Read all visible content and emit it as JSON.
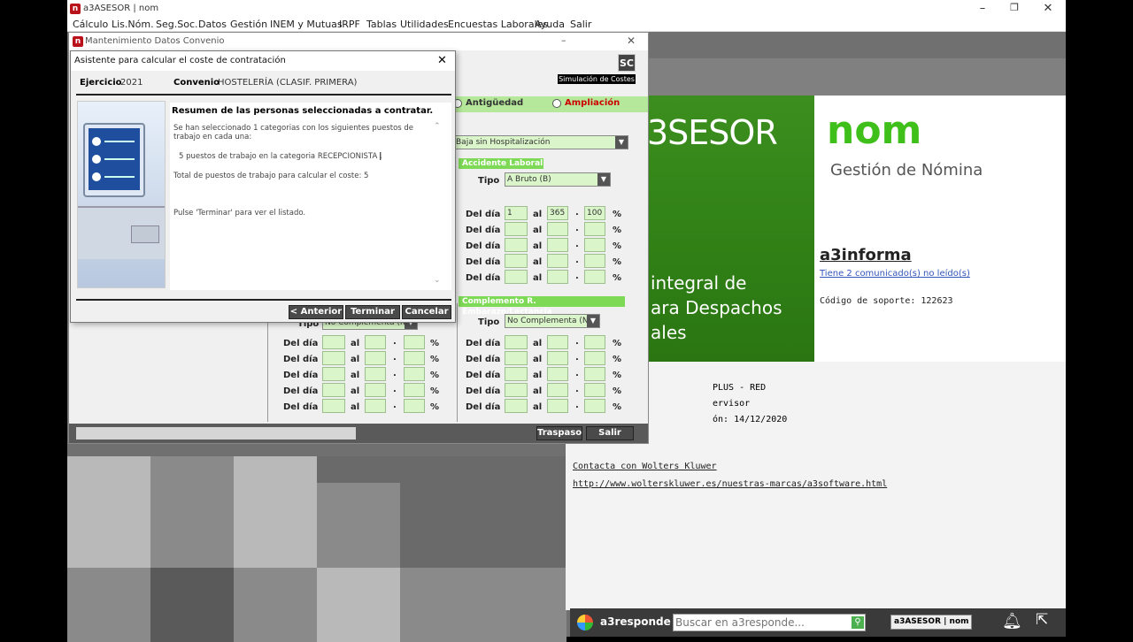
{
  "app": {
    "title": "a3ASESOR | nom",
    "menu": [
      "Cálculo",
      "Lis.Nóm.",
      "Seg.Soc.",
      "Datos",
      "Gestión",
      "INEM y Mutuas",
      "IRPF",
      "Tablas",
      "Utilidades",
      "Encuestas Laborales",
      "Ayuda",
      "Salir"
    ]
  },
  "mant": {
    "title": "Mantenimiento Datos Convenio",
    "sc_label": "SC",
    "sim_label": "Simulación de Costes",
    "radio1": "Antigüedad",
    "radio2": "Ampliación",
    "baja_combo": "Baja sin Hospitalización",
    "accidente_header": "Accidente Laboral",
    "tipo_label": "Tipo",
    "tipo_value": "A Bruto (B)",
    "del_dia": "Del día",
    "al": "al",
    "dot": ".",
    "pct": "%",
    "row1": {
      "from": "1",
      "to": "365",
      "pct": "100"
    },
    "embarazo_header": "Complemento R. Embarazo/Lactancia",
    "tipo2_value": "No Complementa (N)",
    "tipo3_value": "No Complementa (N)",
    "traspaso": "Traspaso",
    "salir": "Salir"
  },
  "wizard": {
    "title": "Asistente para calcular el coste de contratación",
    "ejercicio_label": "Ejercicio",
    "ejercicio_value": "2021",
    "convenio_label": "Convenio",
    "convenio_value": "HOSTELERÍA (CLASIF. PRIMERA)",
    "heading": "Resumen de las personas seleccionadas a contratar.",
    "line1": "Se han seleccionado  1 categorias con los siguientes puestos de trabajo en cada una:",
    "line2": "5 puestos de trabajo en la categoria RECEPCIONISTA .",
    "line3": "Total de puestos de trabajo para calcular el coste:   5",
    "line4": "Pulse 'Terminar' para ver el listado.",
    "anterior": "< Anterior",
    "terminar": "Terminar",
    "cancelar": "Cancelar"
  },
  "splash": {
    "brand_left": "3SESOR",
    "nom": "nom",
    "gestion": "Gestión de Nómina",
    "integral1": "integral de",
    "integral2": "ara Despachos",
    "integral3": "ales",
    "a3informa": "a3informa",
    "comunicados": "Tiene 2 comunicado(s) no leído(s)",
    "soporte": "Código de soporte: 122623",
    "plus": "PLUS - RED",
    "ervisor": "ervisor",
    "fecha": "ón: 14/12/2020",
    "contacta": "Contacta con Wolters Kluwer",
    "url": "http://www.wolterskluwer.es/nuestras-marcas/a3software.html"
  },
  "responde": {
    "label": "a3responde",
    "placeholder": "Buscar en a3responde...",
    "badge": "a3ASESOR | nom"
  }
}
